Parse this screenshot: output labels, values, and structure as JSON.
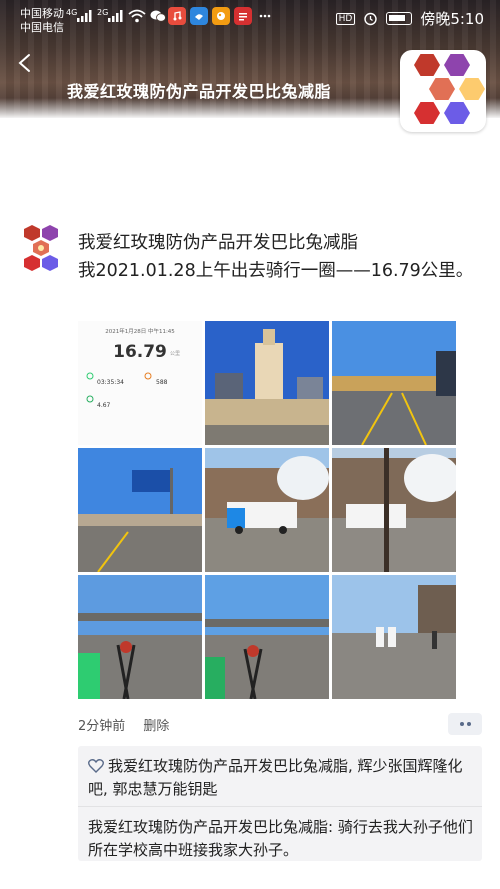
{
  "status_bar": {
    "carrier1": "中国移动",
    "carrier2": "中国电信",
    "net1": "4G",
    "net2": "2G",
    "time": "傍晚5:10",
    "hd": "HD"
  },
  "header": {
    "title": "我爱红玫瑰防伪产品开发巴比兔减脂"
  },
  "post": {
    "author": "我爱红玫瑰防伪产品开发巴比兔减脂",
    "text": "我2021.01.28上午出去骑行一圈——16.79公里。",
    "time_ago": "2分钟前",
    "delete_label": "删除"
  },
  "photos": {
    "fitness": {
      "date": "2021年1月28日 中午11:45",
      "distance": "16.79",
      "unit": "公里",
      "duration": "03:35:34",
      "steps": "588",
      "speed": "4.67"
    }
  },
  "comments": {
    "likes": "我爱红玫瑰防伪产品开发巴比兔减脂, 辉少张国辉隆化吧, 郭忠慧万能钥匙",
    "comment": "我爱红玫瑰防伪产品开发巴比兔减脂: 骑行去我大孙子他们所在学校高中班接我家大孙子。"
  },
  "colors": {
    "accent": "#5a6b8a",
    "comment_bg": "#f3f3f5"
  }
}
